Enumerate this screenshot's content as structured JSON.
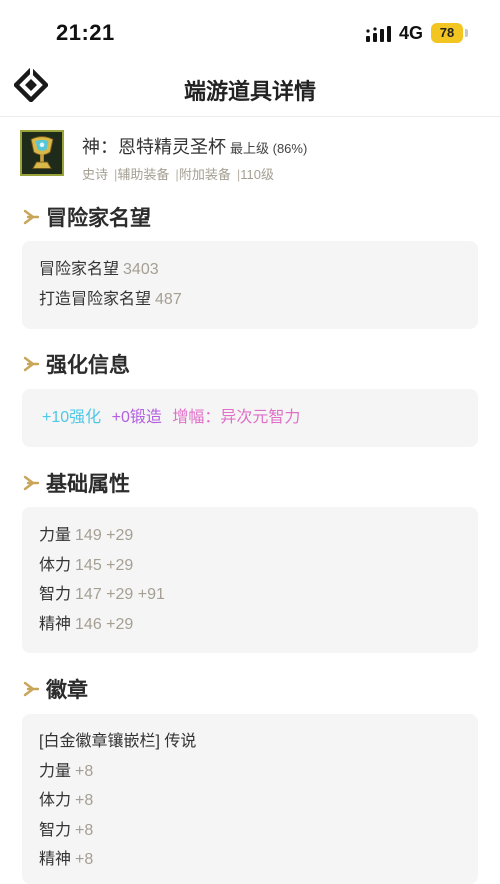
{
  "status_bar": {
    "time": "21:21",
    "network": "4G",
    "battery": "78"
  },
  "nav": {
    "title": "端游道具详情",
    "logo_icon": "diamond-logo-icon"
  },
  "item": {
    "name": "神：恩特精灵圣杯",
    "level": "最上级 (86%)",
    "meta": [
      "史诗",
      "辅助装备",
      "附加装备",
      "110级"
    ],
    "icon": "chalice-icon"
  },
  "sections": {
    "reputation": {
      "title": "冒险家名望",
      "rows": [
        {
          "label": "冒险家名望",
          "value": "3403"
        },
        {
          "label": "打造冒险家名望",
          "value": "487"
        }
      ]
    },
    "enhance": {
      "title": "强化信息",
      "reinforce": "+10强化",
      "forge": "+0锻造",
      "amplify": "增幅：异次元智力",
      "colors": {
        "reinforce": "#4ec8e6",
        "forge": "#b35fe0",
        "amplify": "#e06fc8"
      }
    },
    "base": {
      "title": "基础属性",
      "rows": [
        {
          "label": "力量",
          "value": "149 +29"
        },
        {
          "label": "体力",
          "value": "145 +29"
        },
        {
          "label": "智力",
          "value": "147 +29 +91"
        },
        {
          "label": "精神",
          "value": "146 +29"
        }
      ]
    },
    "emblem": {
      "title": "徽章",
      "slot": "[白金徽章镶嵌栏] 传说",
      "rows": [
        {
          "label": "力量",
          "value": "+8"
        },
        {
          "label": "体力",
          "value": "+8"
        },
        {
          "label": "智力",
          "value": "+8"
        },
        {
          "label": "精神",
          "value": "+8"
        }
      ]
    }
  },
  "colors": {
    "accent_gold": "#c9a55a",
    "value_gray": "#a59f93"
  }
}
